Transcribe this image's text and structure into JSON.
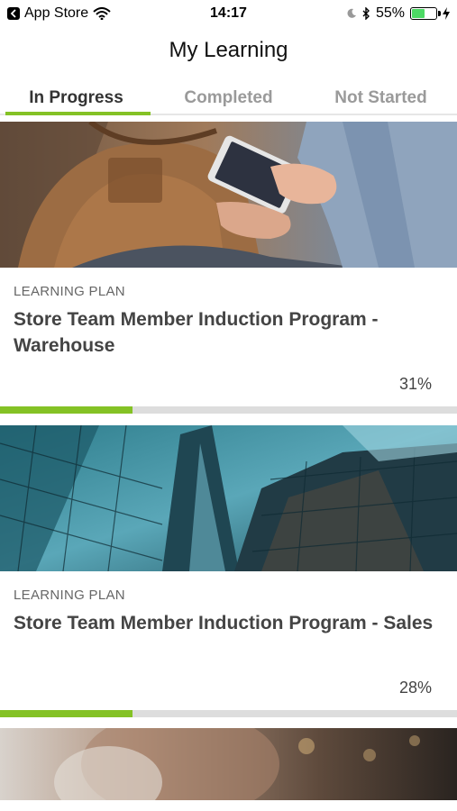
{
  "status_bar": {
    "back_app": "App Store",
    "time": "14:17",
    "battery": "55%",
    "battery_level": 0.55
  },
  "header": {
    "title": "My Learning"
  },
  "tabs": [
    {
      "label": "In Progress",
      "active": true
    },
    {
      "label": "Completed",
      "active": false
    },
    {
      "label": "Not Started",
      "active": false
    }
  ],
  "cards": [
    {
      "type": "LEARNING PLAN",
      "title": "Store Team Member Induction Program - Warehouse",
      "percent": "31%",
      "progress": 0.29,
      "image": "person-using-phone-with-bag"
    },
    {
      "type": "LEARNING PLAN",
      "title": "Store Team Member Induction Program - Sales",
      "percent": "28%",
      "progress": 0.29,
      "image": "glass-office-buildings"
    },
    {
      "image": "person-blurred-background"
    }
  ],
  "colors": {
    "accent": "#84c225",
    "track": "#dddddd"
  }
}
